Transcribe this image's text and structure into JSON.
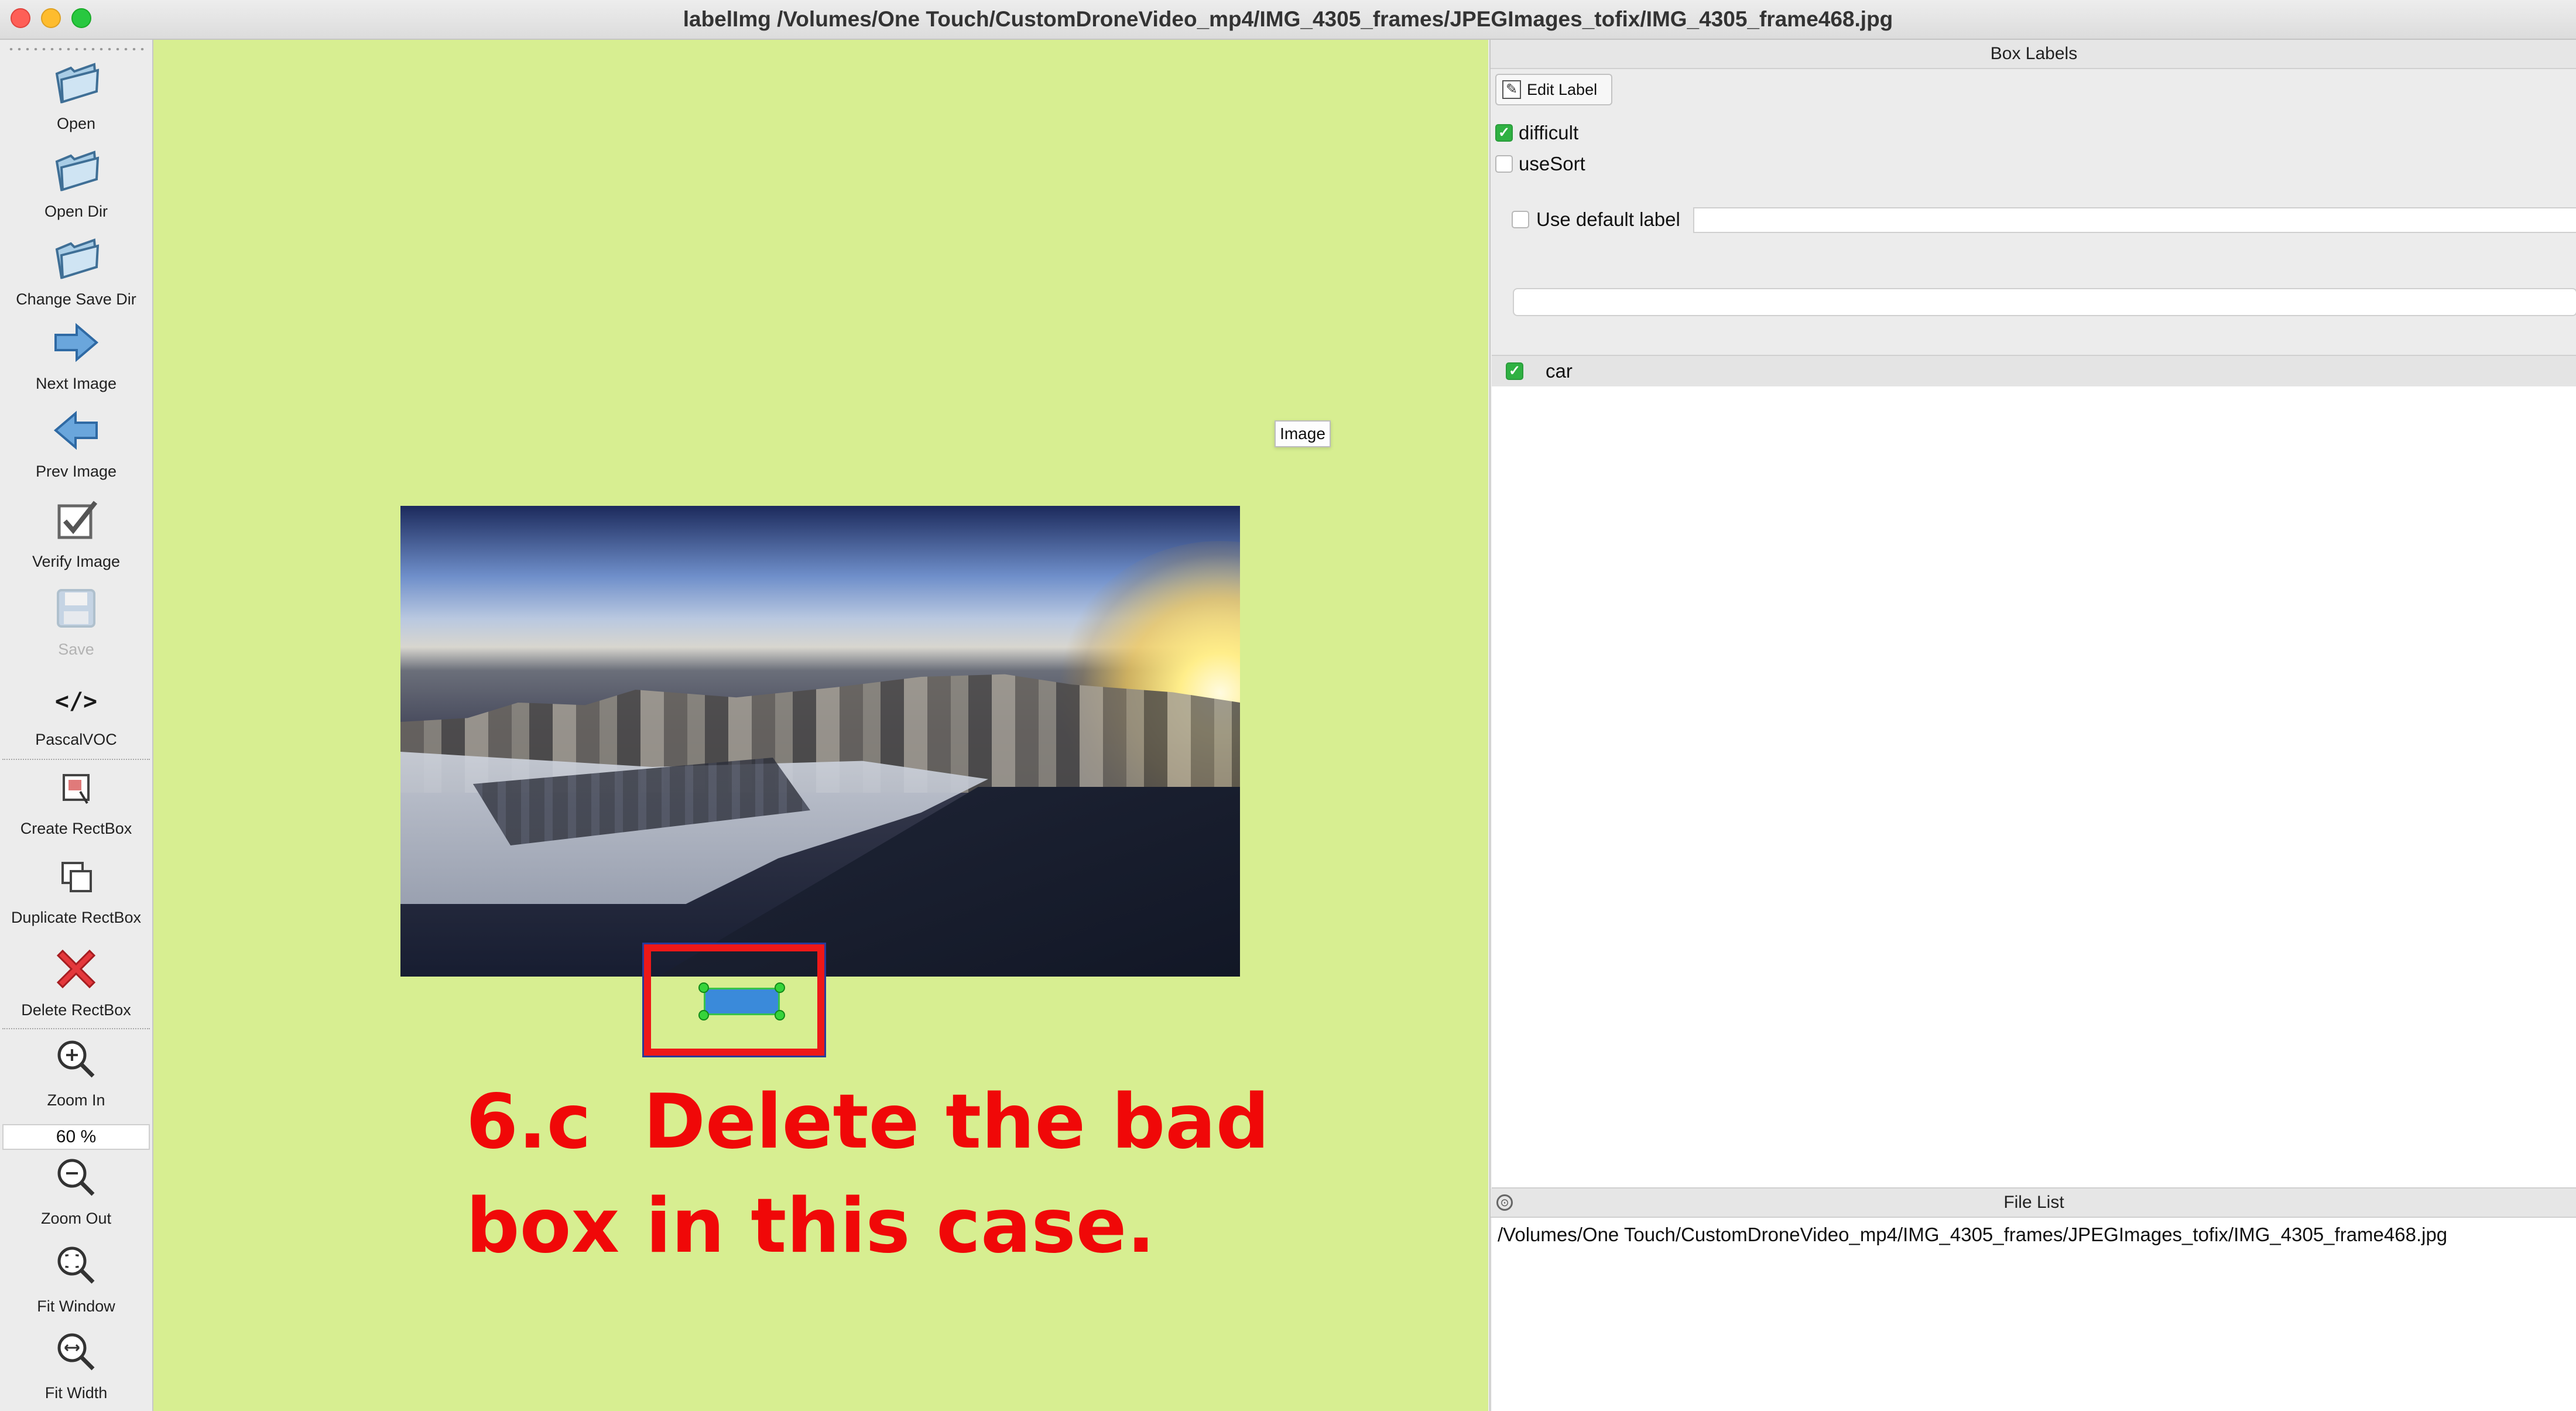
{
  "window": {
    "title": "labelImg /Volumes/One Touch/CustomDroneVideo_mp4/IMG_4305_frames/JPEGImages_tofix/IMG_4305_frame468.jpg"
  },
  "toolbar": {
    "items": [
      {
        "label": "Open",
        "icon": "folder-icon"
      },
      {
        "label": "Open Dir",
        "icon": "folder-icon"
      },
      {
        "label": "Change Save Dir",
        "icon": "folder-icon"
      },
      {
        "label": "Next Image",
        "icon": "arrow-right-icon"
      },
      {
        "label": "Prev Image",
        "icon": "arrow-left-icon"
      },
      {
        "label": "Verify Image",
        "icon": "checkbox-icon"
      },
      {
        "label": "Save",
        "icon": "floppy-icon",
        "disabled": true
      },
      {
        "label": "PascalVOC",
        "icon": "code-icon",
        "glyph": "</>"
      },
      {
        "label": "Create RectBox",
        "icon": "rectbox-icon"
      },
      {
        "label": "Duplicate RectBox",
        "icon": "duplicate-icon"
      },
      {
        "label": "Delete RectBox",
        "icon": "red-x-icon"
      },
      {
        "label": "Zoom In",
        "icon": "zoom-in-icon"
      },
      {
        "label": "Zoom Out",
        "icon": "zoom-out-icon"
      },
      {
        "label": "Fit Window",
        "icon": "fit-window-icon"
      },
      {
        "label": "Fit Width",
        "icon": "fit-width-icon"
      }
    ],
    "zoom_value": "60 %"
  },
  "canvas": {
    "tooltip": "Image",
    "annotation_line1": "6.c  Delete the bad",
    "annotation_line2": "box in this case.",
    "colors": {
      "background": "#d7ee91",
      "annotation": "#f00808",
      "highlight": "#ee1818"
    }
  },
  "box_labels": {
    "dock_title": "Box Labels",
    "edit_label_button": "Edit Label",
    "difficult_label": "difficult",
    "difficult_checked": true,
    "use_sort_label": "useSort",
    "use_sort_checked": false,
    "use_default_label": "Use default label",
    "use_default_checked": false,
    "default_label_value": "",
    "labels": [
      {
        "name": "car",
        "checked": true
      }
    ]
  },
  "file_list": {
    "dock_title": "File List",
    "files": [
      "/Volumes/One Touch/CustomDroneVideo_mp4/IMG_4305_frames/JPEGImages_tofix/IMG_4305_frame468.jpg"
    ]
  }
}
